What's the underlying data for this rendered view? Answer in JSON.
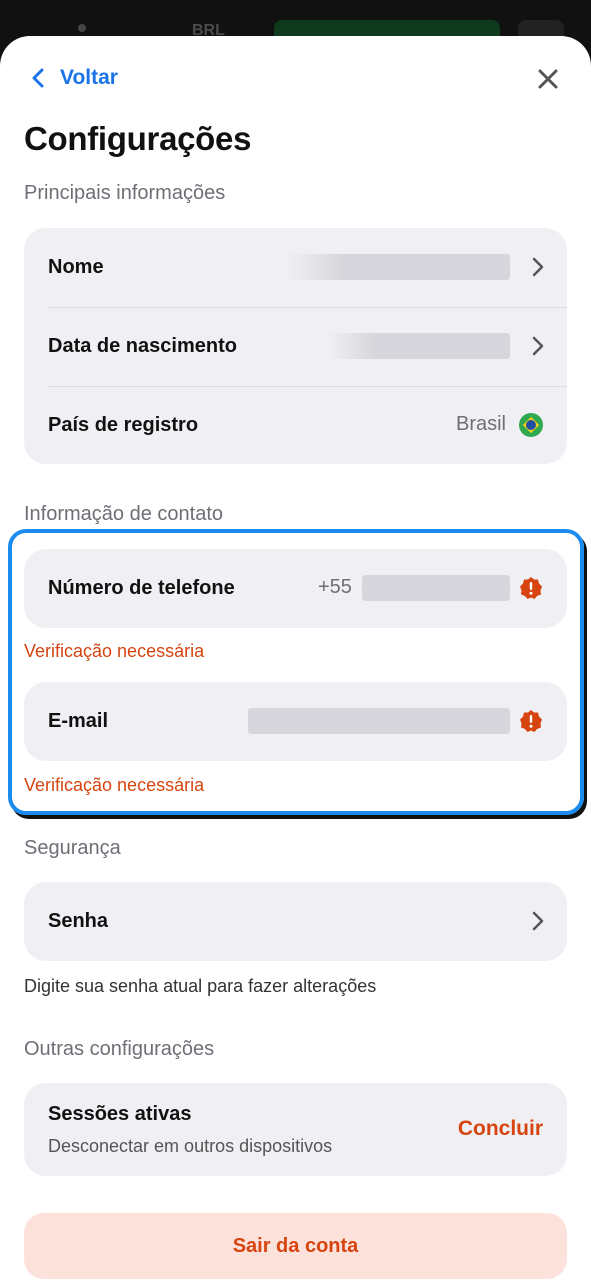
{
  "background": {
    "carrier_text": "BRL"
  },
  "header": {
    "back_label": "Voltar",
    "title": "Configurações"
  },
  "main_info": {
    "section_label": "Principais informações",
    "rows": [
      {
        "label": "Nome"
      },
      {
        "label": "Data de nascimento"
      },
      {
        "label": "País de registro",
        "value": "Brasil"
      }
    ]
  },
  "contact": {
    "section_label": "Informação de contato",
    "phone": {
      "label": "Número de telefone",
      "prefix": "+55",
      "warning": "Verificação necessária"
    },
    "email": {
      "label": "E-mail",
      "warning": "Verificação necessária"
    }
  },
  "security": {
    "section_label": "Segurança",
    "password_label": "Senha",
    "helper": "Digite sua senha atual para fazer alterações"
  },
  "other": {
    "section_label": "Outras configurações",
    "sessions_title": "Sessões ativas",
    "sessions_subtitle": "Desconectar em outros dispositivos",
    "sessions_action": "Concluir"
  },
  "logout_label": "Sair da conta",
  "colors": {
    "accent_blue": "#1a73e8",
    "warning_orange": "#d64510",
    "highlight_blue": "#1a8cf0"
  },
  "icons": [
    "chevron-left-icon",
    "close-icon",
    "chevron-right-icon",
    "brazil-flag-icon",
    "warning-badge-icon"
  ]
}
